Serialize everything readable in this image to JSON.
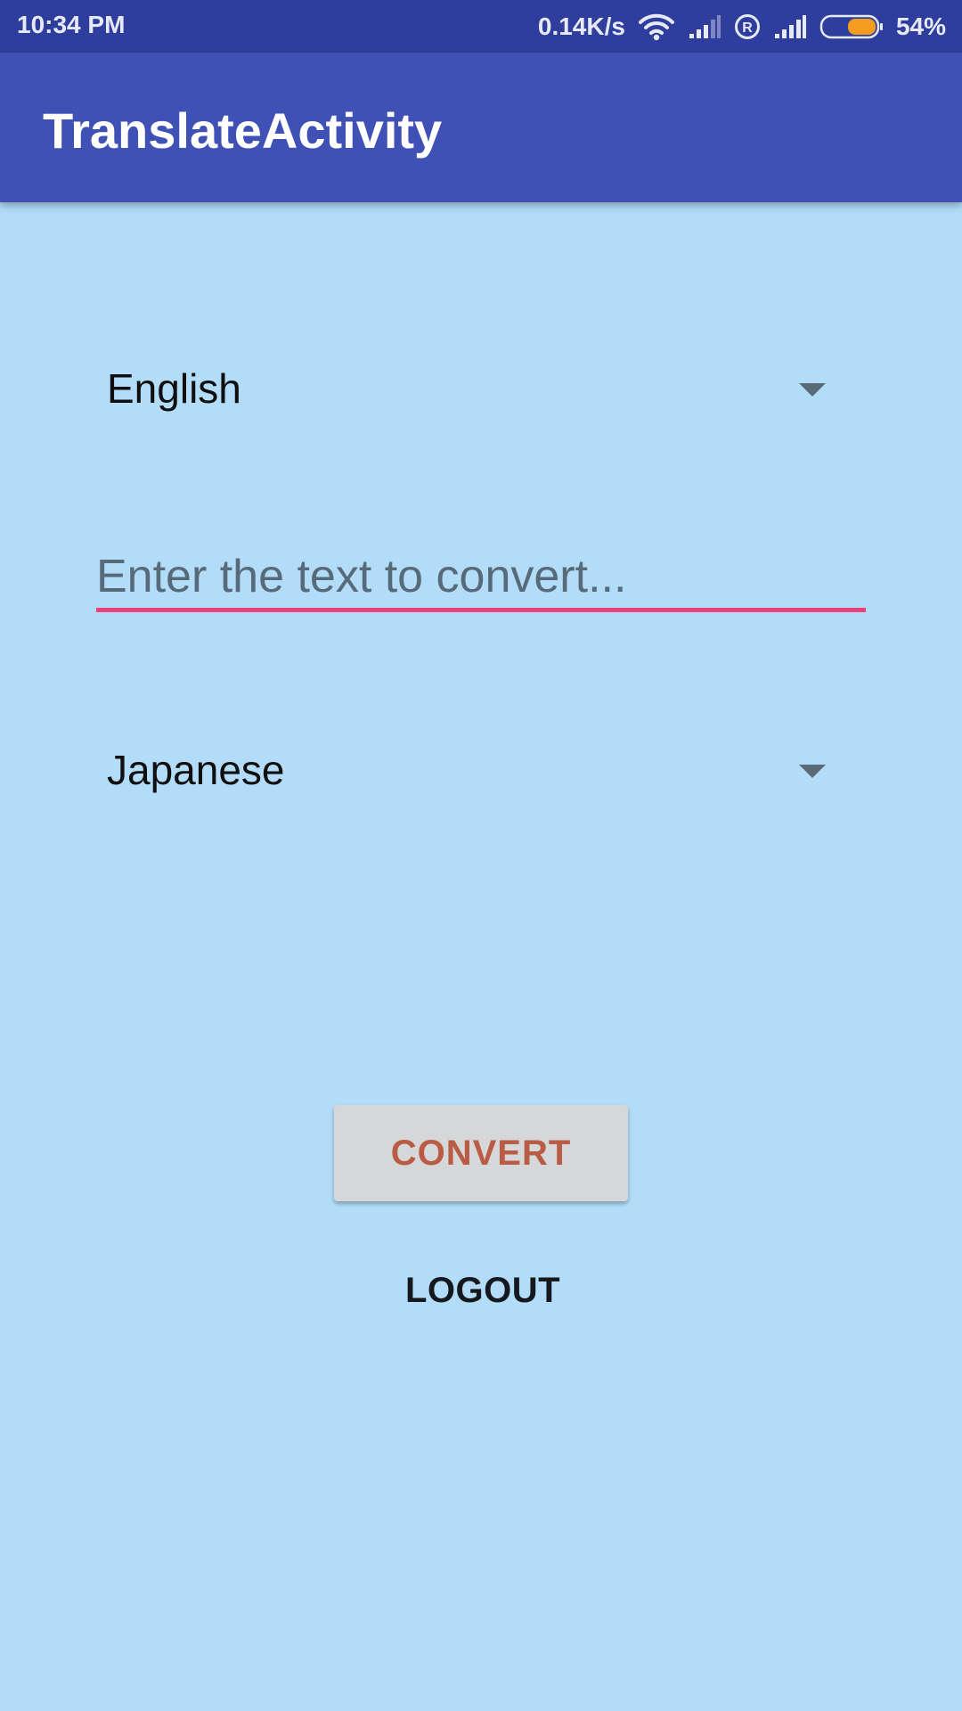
{
  "status_bar": {
    "time": "10:34 PM",
    "net_speed": "0.14K/s",
    "battery_percent": "54%",
    "battery_level": 0.54,
    "icons": [
      "wifi-icon",
      "signal-icon-sim1",
      "registered-icon",
      "signal-icon-sim2",
      "battery-icon"
    ]
  },
  "app_bar": {
    "title": "TranslateActivity"
  },
  "source_language": {
    "selected": "English"
  },
  "input": {
    "value": "",
    "placeholder": "Enter the text to convert..."
  },
  "target_language": {
    "selected": "Japanese"
  },
  "actions": {
    "convert_label": "CONVERT",
    "logout_label": "LOGOUT"
  },
  "colors": {
    "status_bar": "#2F3E9D",
    "app_bar": "#3F51B5",
    "background": "#B2DCF8",
    "accent_underline": "#EC407A",
    "convert_text": "#BA5B45",
    "battery_fill": "#F39C1F"
  }
}
